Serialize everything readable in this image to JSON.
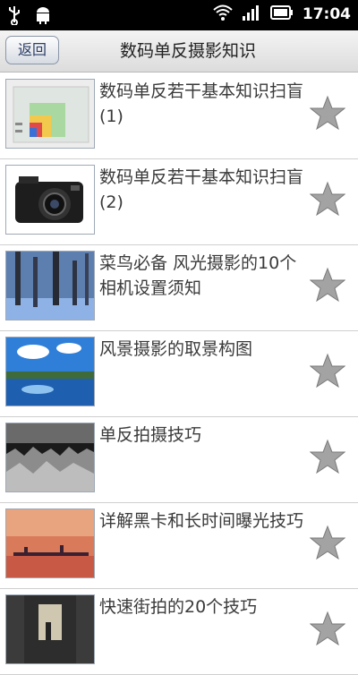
{
  "status_bar": {
    "time": "17:04",
    "icons": [
      "usb-icon",
      "android-icon",
      "wifi-icon",
      "signal-icon",
      "battery-icon"
    ]
  },
  "header": {
    "back_label": "返回",
    "title": "数码单反摄影知识"
  },
  "list": {
    "items": [
      {
        "title": "数码单反若干基本知识扫盲(1)",
        "thumb": "sensor-size-chart"
      },
      {
        "title": "数码单反若干基本知识扫盲(2)",
        "thumb": "compact-camera"
      },
      {
        "title": "菜鸟必备 风光摄影的10个相机设置须知",
        "thumb": "forest-trees"
      },
      {
        "title": "风景摄影的取景构图",
        "thumb": "lake-landscape"
      },
      {
        "title": "单反拍摄技巧",
        "thumb": "grass-bw"
      },
      {
        "title": "详解黑卡和长时间曝光技巧",
        "thumb": "sunset-pier"
      },
      {
        "title": "快速街拍的20个技巧",
        "thumb": "street-scene"
      }
    ]
  },
  "colors": {
    "status_bar_bg": "#000000",
    "title_text": "#222222",
    "item_text": "#3a3a3a",
    "star": "#9a9a9a"
  }
}
